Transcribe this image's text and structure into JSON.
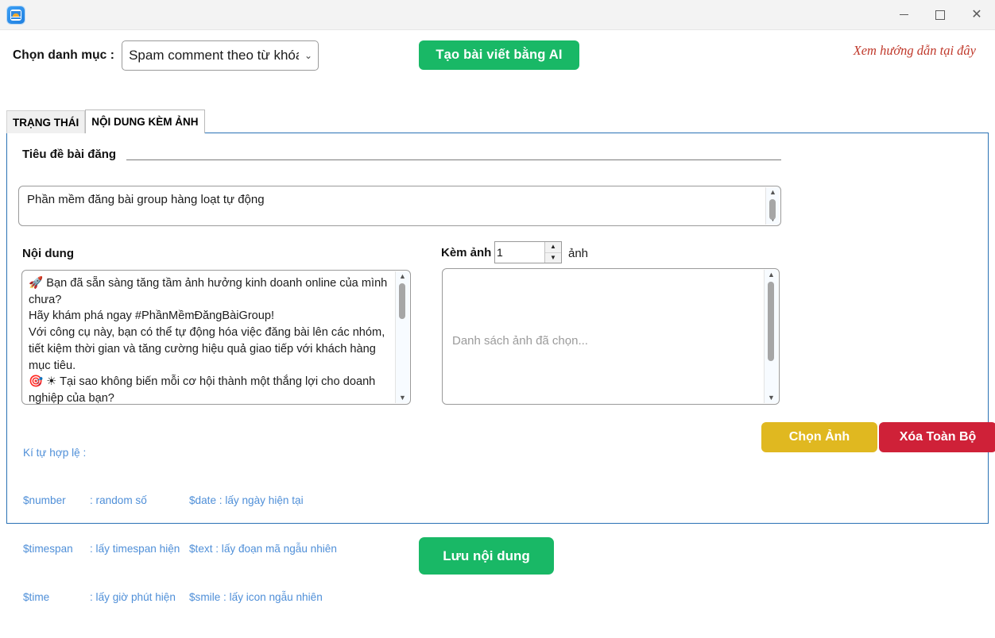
{
  "window": {
    "app_icon": "app-logo-icon",
    "controls": {
      "minimize": "minimize-icon",
      "maximize": "maximize-icon",
      "close": "close-icon"
    }
  },
  "toolbar": {
    "category_label": "Chọn danh mục :",
    "category_value": "Spam comment theo từ khóa",
    "category_arrow": "⌄",
    "ai_button": "Tạo bài viết bằng AI",
    "guide_link": "Xem hướng dẫn tại đây"
  },
  "tabs": [
    {
      "label": "TRẠNG THÁI",
      "active": false
    },
    {
      "label": "NỘI DUNG KÈM ẢNH",
      "active": true
    }
  ],
  "form": {
    "title_label": "Tiêu đề bài đăng",
    "title_value": "Phần mềm đăng bài group hàng loạt tự động",
    "content_label": "Nội dung",
    "content_value": "🚀 Bạn đã sẵn sàng tăng tầm ảnh hưởng kinh doanh online của mình chưa?\nHãy khám phá ngay #PhầnMềmĐăngBàiGroup!\nVới công cụ này, bạn có thể tự động hóa việc đăng bài lên các nhóm, tiết kiệm thời gian và tăng cường hiệu quả giao tiếp với khách hàng mục tiêu.\n🎯 ☀ Tại sao không biến mỗi cơ hội thành một thắng lợi cho doanh nghiệp của bạn?",
    "attach_label": "Kèm ảnh",
    "attach_count": "1",
    "attach_unit": "ảnh",
    "imagelist_placeholder": "Danh sách ảnh đã chọn..."
  },
  "legend": {
    "heading": "Kí tự hợp lệ :",
    "rows": [
      {
        "key": "$number",
        "desc": ": random số",
        "key2": "$date : lấy ngày hiện tại"
      },
      {
        "key": "$timespan",
        "desc": ": lấy timespan hiện",
        "key2": "$text : lấy đoạn mã ngẫu nhiên"
      },
      {
        "key": "$time",
        "desc": ": lấy giờ phút hiện",
        "key2": "$smile : lấy icon ngẫu nhiên"
      }
    ]
  },
  "buttons": {
    "pick_image": "Chọn Ảnh",
    "clear_all": "Xóa Toàn Bộ",
    "save": "Lưu nội dung"
  },
  "colors": {
    "green": "#19b866",
    "gold": "#e0b820",
    "red": "#cf2138",
    "link_red": "#c0392b",
    "legend_blue": "#4f8fd8",
    "panel_border": "#2a72b5"
  }
}
